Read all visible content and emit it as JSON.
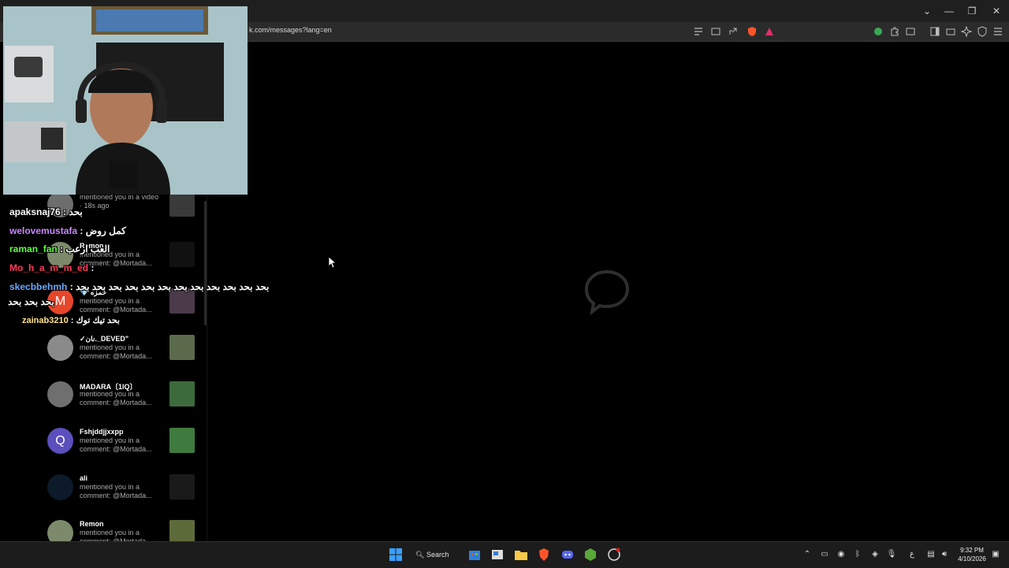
{
  "browser": {
    "url": "k.com/messages?lang=en",
    "window_controls": [
      "chevron-down-icon",
      "minimize-icon",
      "restore-icon",
      "close-icon"
    ]
  },
  "notifications": [
    {
      "name": "",
      "text": "mentioned you in a video · 18s ago",
      "avatar_color": "#6d6d6d"
    },
    {
      "name": "Remon",
      "text": "mentioned you in a comment: @Mortada...",
      "avatar_color": "#7c8a6b"
    },
    {
      "name": "💎 حمزه",
      "text": "mentioned you in a comment: @Mortada...",
      "avatar_color": "#e8462b",
      "avatar_letter": "M"
    },
    {
      "name": "✓نان._DEVED\"",
      "text": "mentioned you in a comment: @Mortada...",
      "avatar_color": "#8a8a8a"
    },
    {
      "name": "MADARA〔1IQ〕",
      "text": "mentioned you in a comment: @Mortada...",
      "avatar_color": "#6f6f6f"
    },
    {
      "name": "Fshjddjjxxpp",
      "text": "mentioned you in a comment: @Mortada...",
      "avatar_color": "#5b4fbd",
      "avatar_letter": "Q"
    },
    {
      "name": "ali",
      "text": "mentioned you in a comment: @Mortada...",
      "avatar_color": "#0c1a2a"
    },
    {
      "name": "Remon",
      "text": "mentioned you in a comment: @Mortada...",
      "avatar_color": "#7c8a6b"
    }
  ],
  "chat": [
    {
      "user": "apaksnaj76",
      "color": "#ffffff",
      "message": " : بحد"
    },
    {
      "user": "welovemustafa",
      "color": "#c786ff",
      "message": " : كمل روض"
    },
    {
      "user": "raman_fan",
      "color": "#5bff3c",
      "message": " : العب ارعب"
    },
    {
      "user": "Mo_h_a_m_m_ed",
      "color": "#ff3b5c",
      "message": " :"
    },
    {
      "user": "skecbbehmh",
      "color": "#6aa7ff",
      "message": " : بحد بحد بحد بحد بحد بحد بحد بحد بحد بحد بحد بحد"
    },
    {
      "user": "",
      "color": "#ffffff",
      "message": "بحد بحد بحد"
    },
    {
      "user": "zainab3210",
      "color": "#ffe28a",
      "message": " : بحد تيك توك"
    }
  ],
  "taskbar": {
    "search_label": "Search",
    "clock_time": "9:32 PM",
    "clock_date": "4/10/2026",
    "tray_lang": "ع"
  },
  "colors": {
    "accent_blue": "#0a84ff",
    "brave_orange": "#fb542b"
  }
}
